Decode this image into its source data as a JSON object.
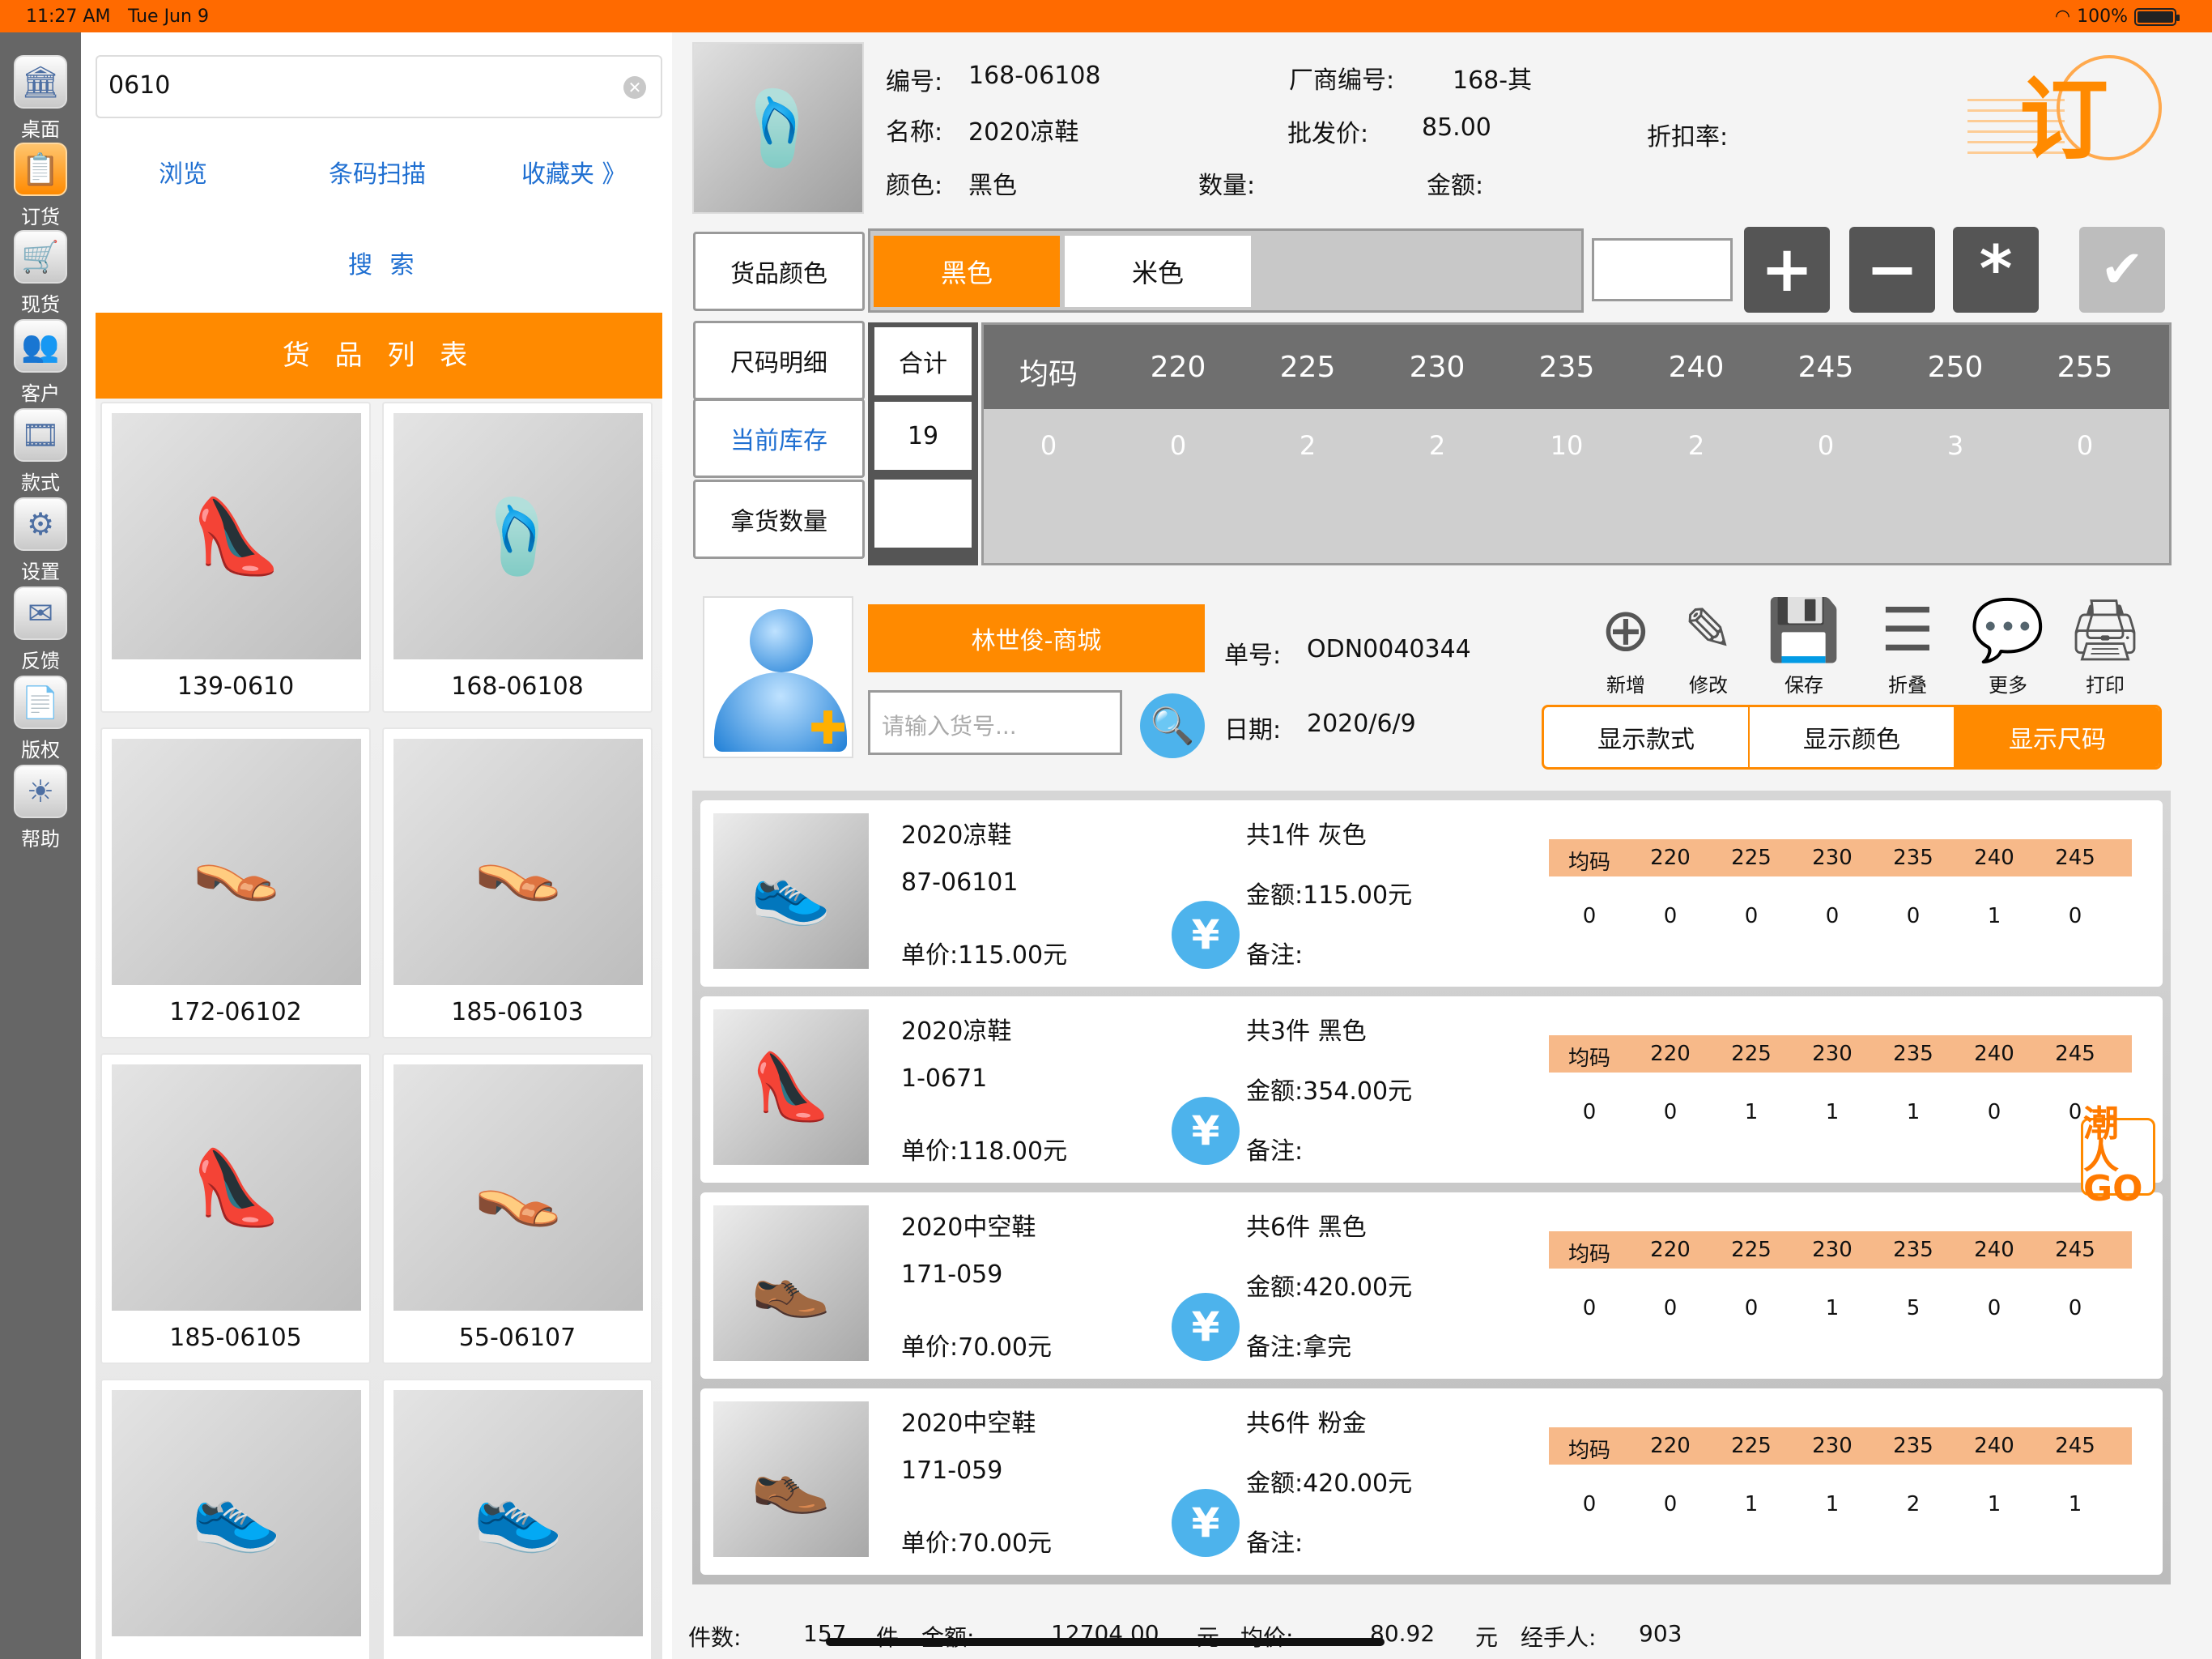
{
  "status_bar": {
    "time": "11:27 AM",
    "date": "Tue Jun 9",
    "battery": "100%"
  },
  "rail": {
    "items": [
      {
        "label": "桌面",
        "icon": "bank-icon"
      },
      {
        "label": "订货",
        "icon": "order-icon"
      },
      {
        "label": "现货",
        "icon": "basket-icon"
      },
      {
        "label": "客户",
        "icon": "customer-icon"
      },
      {
        "label": "款式",
        "icon": "style-icon"
      },
      {
        "label": "设置",
        "icon": "settings-icon"
      },
      {
        "label": "反馈",
        "icon": "mail-icon"
      },
      {
        "label": "版权",
        "icon": "copyright-icon"
      },
      {
        "label": "帮助",
        "icon": "help-icon"
      }
    ]
  },
  "left": {
    "search_value": "0610",
    "nav": {
      "browse": "浏览",
      "scan": "条码扫描",
      "favorites": "收藏夹 》"
    },
    "search_label": "搜 索",
    "list_title": "货 品 列 表",
    "products": [
      "139-0610",
      "168-06108",
      "172-06102",
      "185-06103",
      "185-06105",
      "55-06107",
      "",
      ""
    ]
  },
  "product": {
    "code_label": "编号:",
    "code": "168-06108",
    "vendor_label": "厂商编号:",
    "vendor": "168-其",
    "name_label": "名称:",
    "name": "2020凉鞋",
    "wholesale_label": "批发价:",
    "wholesale": "85.00",
    "discount_label": "折扣率:",
    "color_label": "颜色:",
    "color": "黑色",
    "qty_label": "数量:",
    "amount_label": "金额:",
    "stamp": "订"
  },
  "colors": {
    "label": "货品颜色",
    "options": [
      "黑色",
      "米色"
    ],
    "selected": "黑色"
  },
  "sizes": {
    "detail_label": "尺码明细",
    "stock_label": "当前库存",
    "take_label": "拿货数量",
    "total_label": "合计",
    "stock_total": "19",
    "headers": [
      "均码",
      "220",
      "225",
      "230",
      "235",
      "240",
      "245",
      "250",
      "255"
    ],
    "stock": [
      "0",
      "0",
      "2",
      "2",
      "10",
      "2",
      "0",
      "3",
      "0"
    ]
  },
  "ops": {
    "plus": "+",
    "minus": "−",
    "multiply": "*",
    "confirm": "✔"
  },
  "order": {
    "customer": "林世俊-商城",
    "goods_placeholder": "请输入货号...",
    "no_label": "单号:",
    "no": "ODN0040344",
    "date_label": "日期:",
    "date": "2020/6/9",
    "tools": [
      "新增",
      "修改",
      "保存",
      "折叠",
      "更多",
      "打印"
    ],
    "view_tabs": [
      "显示款式",
      "显示颜色",
      "显示尺码"
    ],
    "view_selected": "显示尺码"
  },
  "order_items": [
    {
      "name": "2020凉鞋",
      "code": "87-06101",
      "price": "单价:115.00元",
      "summary": "共1件 灰色",
      "amount": "金额:115.00元",
      "note": "备注:",
      "sizes": [
        "均码",
        "220",
        "225",
        "230",
        "235",
        "240",
        "245"
      ],
      "qty": [
        "0",
        "0",
        "0",
        "0",
        "0",
        "1",
        "0"
      ]
    },
    {
      "name": "2020凉鞋",
      "code": "1-0671",
      "price": "单价:118.00元",
      "summary": "共3件 黑色",
      "amount": "金额:354.00元",
      "note": "备注:",
      "sizes": [
        "均码",
        "220",
        "225",
        "230",
        "235",
        "240",
        "245"
      ],
      "qty": [
        "0",
        "0",
        "1",
        "1",
        "1",
        "0",
        "0"
      ]
    },
    {
      "name": "2020中空鞋",
      "code": "171-059",
      "price": "单价:70.00元",
      "summary": "共6件 黑色",
      "amount": "金额:420.00元",
      "note": "备注:拿完",
      "sizes": [
        "均码",
        "220",
        "225",
        "230",
        "235",
        "240",
        "245"
      ],
      "qty": [
        "0",
        "0",
        "0",
        "1",
        "5",
        "0",
        "0"
      ]
    },
    {
      "name": "2020中空鞋",
      "code": "171-059",
      "price": "单价:70.00元",
      "summary": "共6件 粉金",
      "amount": "金额:420.00元",
      "note": "备注:",
      "sizes": [
        "均码",
        "220",
        "225",
        "230",
        "235",
        "240",
        "245"
      ],
      "qty": [
        "0",
        "0",
        "1",
        "1",
        "2",
        "1",
        "1"
      ]
    }
  ],
  "badge": "潮人GO",
  "footer": {
    "count_label": "件数:",
    "count": "157",
    "count_unit": "件",
    "amount_label": "金额:",
    "amount": "12704.00",
    "amount_unit": "元",
    "avg_label": "均价:",
    "avg": "80.92",
    "avg_unit": "元",
    "handler_label": "经手人:",
    "handler": "903"
  },
  "colors_theme": {
    "accent": "#ff8a00",
    "status_bar": "#ff6a00",
    "link": "#1f6fd1",
    "rail": "#666666"
  }
}
